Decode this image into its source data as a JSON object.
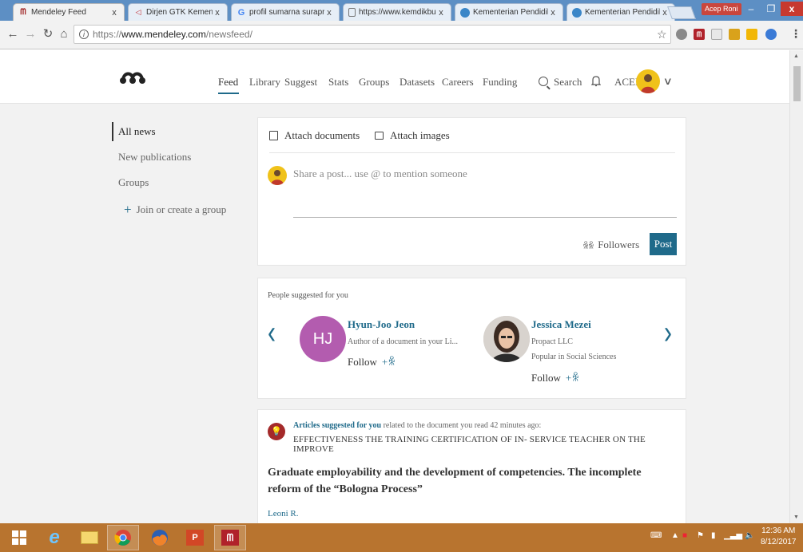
{
  "browser": {
    "tabs": [
      {
        "label": "Mendeley Feed",
        "icon": "mendeley-icon",
        "active": true
      },
      {
        "label": "Dirjen GTK Kemendikbu",
        "icon": "gtk-icon"
      },
      {
        "label": "profil sumarna surapran",
        "icon": "google-icon"
      },
      {
        "label": "https://www.kemdikbud",
        "icon": "page-icon"
      },
      {
        "label": "Kementerian Pendidikan",
        "icon": "kemdikbud-icon"
      },
      {
        "label": "Kementerian Pendidikan",
        "icon": "kemdikbud-icon"
      }
    ],
    "close_glyph": "x",
    "profile_name": "Acep Roni",
    "url_scheme": "https://",
    "url_host": "www.mendeley.com",
    "url_path": "/newsfeed/",
    "window_buttons": {
      "minimize": "–",
      "maximize": "❐",
      "close": "x"
    }
  },
  "header": {
    "nav": [
      "Feed",
      "Library",
      "Suggest",
      "Stats",
      "Groups",
      "Datasets",
      "Careers",
      "Funding"
    ],
    "active_nav": "Feed",
    "search_label": "Search",
    "user_label": "ACEP"
  },
  "sidebar": {
    "items": [
      "All news",
      "New publications",
      "Groups"
    ],
    "join_label": "Join or create a group",
    "join_glyph": "+"
  },
  "composer": {
    "attach_documents": "Attach documents",
    "attach_images": "Attach images",
    "placeholder": "Share a post... use @ to mention someone",
    "audience_label": "Followers",
    "post_label": "Post"
  },
  "suggestions": {
    "title": "People suggested for you",
    "prev_glyph": "‹",
    "next_glyph": "›",
    "people": [
      {
        "initials": "HJ",
        "name": "Hyun-Joo Jeon",
        "line1": "Author of a document in your Li...",
        "line2": "",
        "follow_label": "Follow"
      },
      {
        "initials": "",
        "name": "Jessica Mezei",
        "line1": "Propact LLC",
        "line2": "Popular in Social Sciences",
        "follow_label": "Follow"
      }
    ]
  },
  "articles": {
    "heading_strong": "Articles suggested for you",
    "heading_rest": " related to the document you read 42 minutes ago:",
    "source_document": "EFFECTIVENESS THE TRAINING CERTIFICATION OF IN- SERVICE TEACHER ON THE IMPROVE",
    "title": "Graduate employability and the development of competencies. The incomplete reform of the “Bologna Process”",
    "author": "Leoni R."
  },
  "taskbar": {
    "apps": [
      "windows-start",
      "internet-explorer",
      "file-explorer",
      "chrome",
      "firefox",
      "powerpoint",
      "mendeley"
    ],
    "time": "12:36 AM",
    "date": "8/12/2017"
  },
  "colors": {
    "accent": "#1f6a8a",
    "background": "#f2f2f2",
    "taskbar": "#b8742f",
    "avatar_hj": "#b35caf",
    "tabstrip": "#5d8fc4"
  }
}
